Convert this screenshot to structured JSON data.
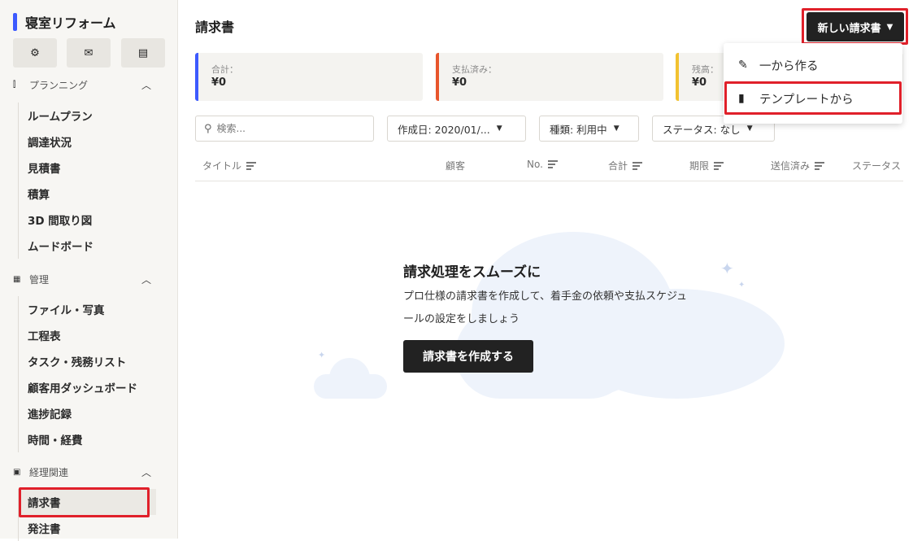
{
  "sidebar": {
    "project_title": "寝室リフォーム",
    "quick_actions": [
      {
        "icon": "gear-icon",
        "glyph": "⚙"
      },
      {
        "icon": "mail-icon",
        "glyph": "✉"
      },
      {
        "icon": "note-icon",
        "glyph": "▤"
      }
    ],
    "sections": [
      {
        "title": "プランニング",
        "icon": "planning-icon",
        "glyph": "⫿",
        "items": [
          "ルームプラン",
          "調達状況",
          "見積書",
          "積算",
          "3D 間取り図",
          "ムードボード"
        ]
      },
      {
        "title": "管理",
        "icon": "calendar-icon",
        "glyph": "▦",
        "items": [
          "ファイル・写真",
          "工程表",
          "タスク・残務リスト",
          "顧客用ダッシュボード",
          "進捗記録",
          "時間・経費"
        ]
      },
      {
        "title": "経理関連",
        "icon": "receipt-icon",
        "glyph": "▣",
        "items": [
          "請求書",
          "発注書"
        ]
      }
    ],
    "active_item": "請求書"
  },
  "header": {
    "title": "請求書",
    "new_button_label": "新しい請求書"
  },
  "summary": [
    {
      "label": "合計：",
      "value": "¥0",
      "color": "#3d5afe"
    },
    {
      "label": "支払済み：",
      "value": "¥0",
      "color": "#e8552c"
    },
    {
      "label": "残高：",
      "value": "¥0",
      "color": "#f2c230"
    }
  ],
  "filters": {
    "search_placeholder": "検索...",
    "created_date": "作成日: 2020/01/...",
    "type": "種類: 利用中",
    "status": "ステータス: なし"
  },
  "table": {
    "columns": [
      "タイトル",
      "顧客",
      "No.",
      "合計",
      "期限",
      "送信済み",
      "ステータス"
    ]
  },
  "empty_state": {
    "title": "請求処理をスムーズに",
    "description": "プロ仕様の請求書を作成して、着手金の依頼や支払スケジュールの設定をしましょう",
    "button_label": "請求書を作成する"
  },
  "dropdown": {
    "items": [
      {
        "label": "一から作る",
        "icon": "edit-icon",
        "glyph": "✎"
      },
      {
        "label": "テンプレートから",
        "icon": "document-icon",
        "glyph": "▮"
      }
    ]
  },
  "colors": {
    "highlight": "#e0202a",
    "accent_blue": "#3d5afe",
    "button_dark": "#222222"
  }
}
